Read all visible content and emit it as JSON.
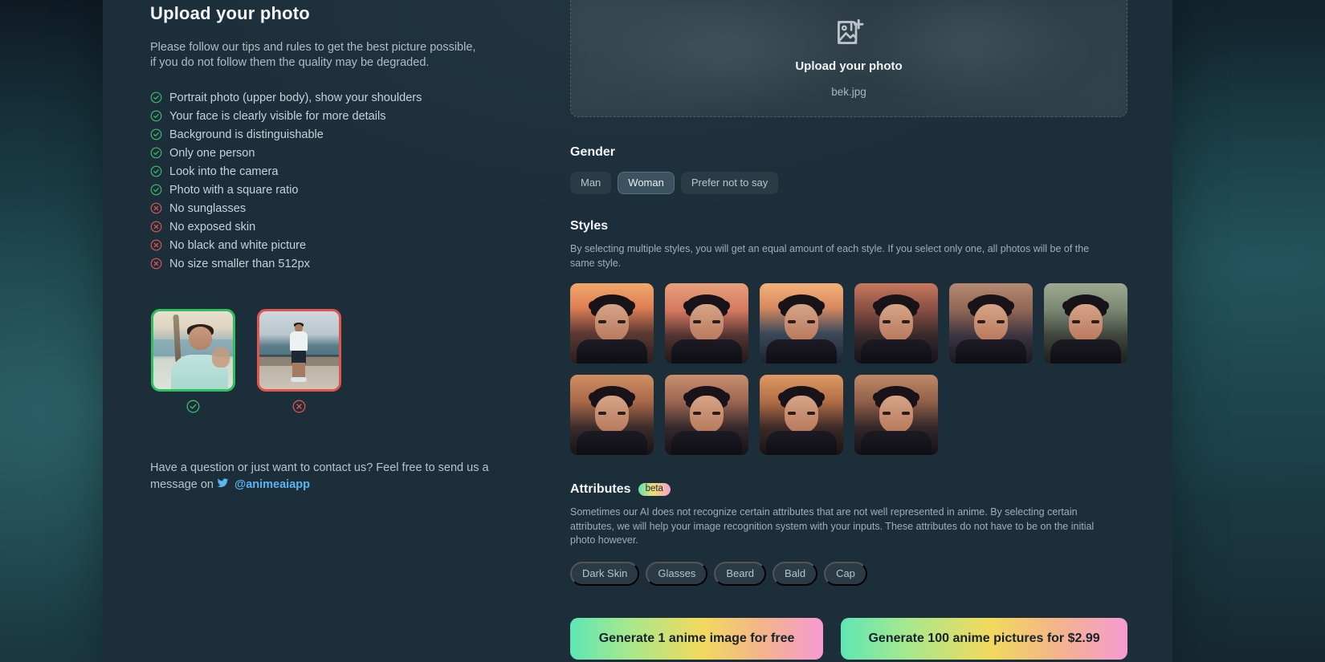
{
  "left": {
    "title": "Upload your photo",
    "intro": "Please follow our tips and rules to get the best picture possible, if you do not follow them the quality may be degraded.",
    "rules": [
      {
        "text": "Portrait photo (upper body), show your shoulders",
        "type": "check"
      },
      {
        "text": "Your face is clearly visible for more details",
        "type": "check"
      },
      {
        "text": "Background is distinguishable",
        "type": "check"
      },
      {
        "text": "Only one person",
        "type": "check"
      },
      {
        "text": "Look into the camera",
        "type": "check"
      },
      {
        "text": "Photo with a square ratio",
        "type": "check"
      },
      {
        "text": "No sunglasses",
        "type": "cross"
      },
      {
        "text": "No exposed skin",
        "type": "cross"
      },
      {
        "text": "No black and white picture",
        "type": "cross"
      },
      {
        "text": "No size smaller than 512px",
        "type": "cross"
      }
    ],
    "examples": [
      {
        "status": "good",
        "status_icon": "check-circle-icon"
      },
      {
        "status": "bad",
        "status_icon": "cross-circle-icon"
      }
    ],
    "contact": {
      "text": "Have a question or just want to contact us? Feel free to send us a message on",
      "icon": "twitter-icon",
      "handle": "@animeaiapp"
    }
  },
  "upload": {
    "icon": "image-add-icon",
    "title": "Upload your photo",
    "filename": "bek.jpg"
  },
  "gender": {
    "title": "Gender",
    "options": [
      {
        "label": "Man",
        "selected": false
      },
      {
        "label": "Woman",
        "selected": true
      },
      {
        "label": "Prefer not to say",
        "selected": false
      }
    ]
  },
  "styles": {
    "title": "Styles",
    "description": "By selecting multiple styles, you will get an equal amount of each style. If you select only one, all photos will be of the same style.",
    "items": [
      {
        "name": "style-1",
        "bg": "linear-gradient(180deg,#f0a86a 0%,#e07f55 30%,#5d3a33 62%,#2a1d1c 100%)"
      },
      {
        "name": "style-2",
        "bg": "linear-gradient(180deg,#e8a07c 0%,#d4795f 34%,#4f3331 66%,#221819 100%)"
      },
      {
        "name": "style-3",
        "bg": "linear-gradient(180deg,#f2b27a 0%,#d98a5f 30%,#3d4a5c 62%,#1b2430 100%)"
      },
      {
        "name": "style-4",
        "bg": "linear-gradient(180deg,#c77a5e 0%,#8a4f44 32%,#3a2a2c 64%,#16121a 100%)"
      },
      {
        "name": "style-5",
        "bg": "linear-gradient(180deg,#b58a72 0%,#8f6554 34%,#3b3440 66%,#191721 100%)"
      },
      {
        "name": "style-6",
        "bg": "linear-gradient(180deg,#9fa890 0%,#7b8a74 32%,#40443d 66%,#1c1f1c 100%)"
      },
      {
        "name": "style-7",
        "bg": "linear-gradient(180deg,#d08f63 0%,#a8684a 34%,#3a2c2b 66%,#181316 100%)"
      },
      {
        "name": "style-8",
        "bg": "linear-gradient(180deg,#c98f6f 0%,#9a6550 34%,#36292c 66%,#151117 100%)"
      },
      {
        "name": "style-9",
        "bg": "linear-gradient(180deg,#e09a64 0%,#b06c45 34%,#3c2a26 66%,#191212 100%)"
      },
      {
        "name": "style-10",
        "bg": "linear-gradient(180deg,#c08a68 0%,#8f5f48 34%,#332729 66%,#141016 100%)"
      }
    ]
  },
  "attributes": {
    "title": "Attributes",
    "badge": "beta",
    "description": "Sometimes our AI does not recognize certain attributes that are not well represented in anime. By selecting certain attributes, we will help your image recognition system with your inputs. These attributes do not have to be on the initial photo however.",
    "chips": [
      {
        "label": "Dark Skin"
      },
      {
        "label": "Glasses"
      },
      {
        "label": "Beard"
      },
      {
        "label": "Bald"
      },
      {
        "label": "Cap"
      }
    ]
  },
  "cta": {
    "free_label": "Generate 1 anime image for free",
    "paid_label": "Generate 100 anime pictures for $2.99"
  },
  "colors": {
    "check": "#3fbf6a",
    "cross": "#e2554f",
    "panel": "#1c2e39",
    "link": "#5ab5f0"
  }
}
